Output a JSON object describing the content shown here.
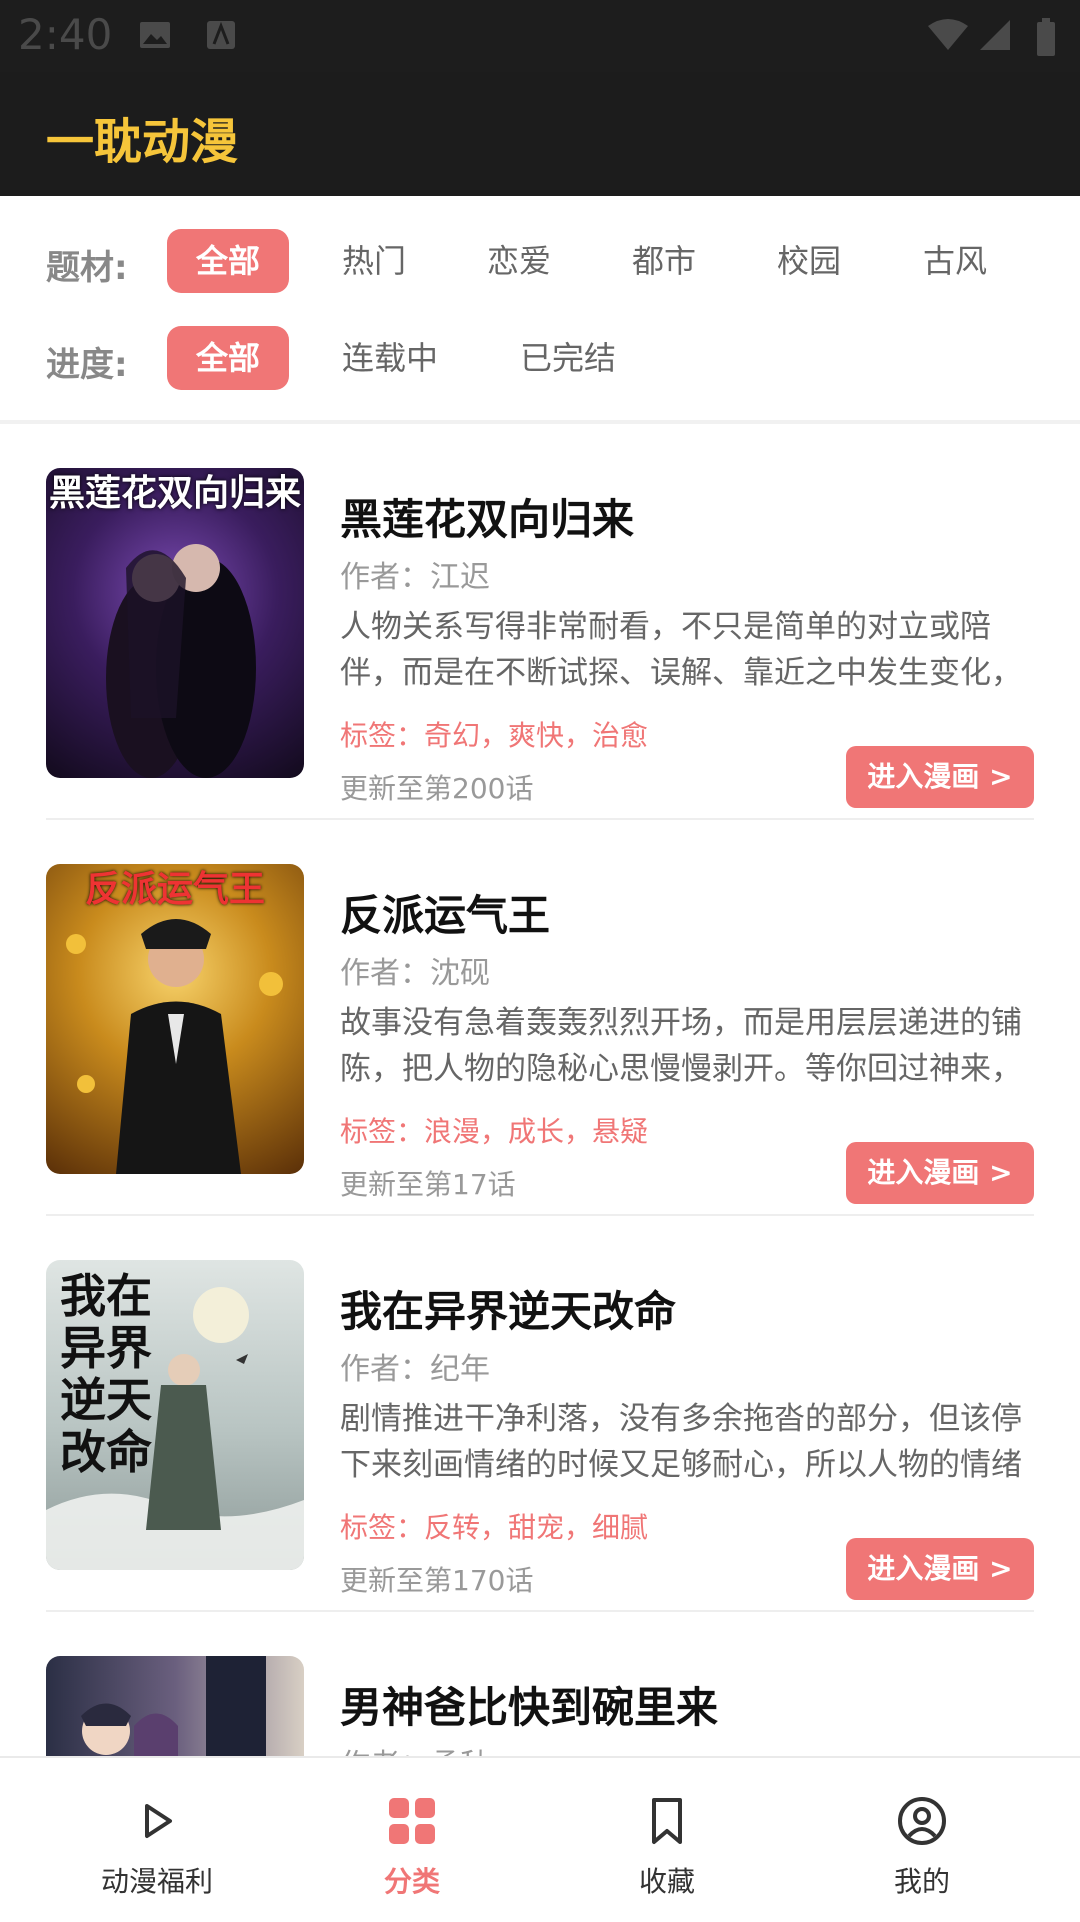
{
  "status_bar": {
    "time": "2:40"
  },
  "app": {
    "title": "一耽动漫"
  },
  "filters": {
    "genre": {
      "label": "题材:",
      "options": [
        "全部",
        "热门",
        "恋爱",
        "都市",
        "校园",
        "古风"
      ],
      "selected": "全部"
    },
    "progress": {
      "label": "进度:",
      "options": [
        "全部",
        "连载中",
        "已完结"
      ],
      "selected": "全部"
    }
  },
  "list": [
    {
      "title": "黑莲花双向归来",
      "cover_text": "黑莲花双向归来",
      "author": "作者：江迟",
      "description": "人物关系写得非常耐看，不只是简单的对立或陪伴，而是在不断试探、误解、靠近之中发生变化，",
      "tags": "标签：奇幻，爽快，治愈",
      "update": "更新至第200话",
      "button": "进入漫画 >"
    },
    {
      "title": "反派运气王",
      "cover_text": "反派运气王",
      "author": "作者：沈砚",
      "description": "故事没有急着轰轰烈烈开场，而是用层层递进的铺陈，把人物的隐秘心思慢慢剥开。等你回过神来，",
      "tags": "标签：浪漫，成长，悬疑",
      "update": "更新至第17话",
      "button": "进入漫画 >"
    },
    {
      "title": "我在异界逆天改命",
      "cover_text": "我在异界逆天改命",
      "author": "作者：纪年",
      "description": "剧情推进干净利落，没有多余拖沓的部分，但该停下来刻画情绪的时候又足够耐心，所以人物的情绪",
      "tags": "标签：反转，甜宠，细腻",
      "update": "更新至第170话",
      "button": "进入漫画 >"
    },
    {
      "title": "男神爸比快到碗里来",
      "cover_text": "",
      "author": "作者：孟秋",
      "description": "",
      "tags": "",
      "update": "",
      "button": ""
    }
  ],
  "bottom_nav": [
    {
      "label": "动漫福利",
      "icon": "play-icon",
      "active": false
    },
    {
      "label": "分类",
      "icon": "grid-icon",
      "active": true
    },
    {
      "label": "收藏",
      "icon": "bookmark-icon",
      "active": false
    },
    {
      "label": "我的",
      "icon": "user-circle-icon",
      "active": false
    }
  ],
  "colors": {
    "accent": "#f07676",
    "title": "#f6c53a",
    "header_bg": "#1c1c1c"
  }
}
